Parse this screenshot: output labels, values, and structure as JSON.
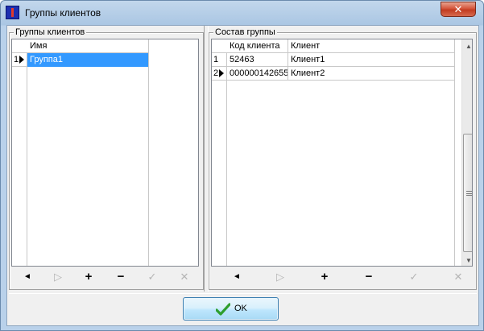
{
  "window": {
    "title": "Группы клиентов",
    "close_glyph": "✕"
  },
  "left_panel": {
    "title": "Группы клиентов",
    "columns": [
      "Имя"
    ],
    "rows": [
      {
        "num": "1",
        "name": "Группа1",
        "current": true,
        "selected": true
      }
    ],
    "nav": [
      "◄",
      "▷",
      "+",
      "−",
      "✓",
      "✕"
    ]
  },
  "right_panel": {
    "title": "Состав группы",
    "columns": [
      "Код клиента",
      "Клиент"
    ],
    "rows": [
      {
        "num": "1",
        "code": "52463",
        "client": "Клиент1",
        "current": false
      },
      {
        "num": "2",
        "code": "000000142655",
        "client": "Клиент2",
        "current": true
      }
    ],
    "nav": [
      "◄",
      "▷",
      "+",
      "−",
      "✓",
      "✕"
    ],
    "scrollbar": {
      "up": "▲",
      "down": "▼"
    }
  },
  "footer": {
    "ok_label": "OK"
  },
  "colors": {
    "selection": "#3399ff",
    "ok_check": "#2e9e2e"
  },
  "icons": {
    "nav_icons": [
      "prior-icon",
      "next-icon",
      "insert-icon",
      "delete-icon",
      "post-icon",
      "cancel-icon"
    ]
  }
}
